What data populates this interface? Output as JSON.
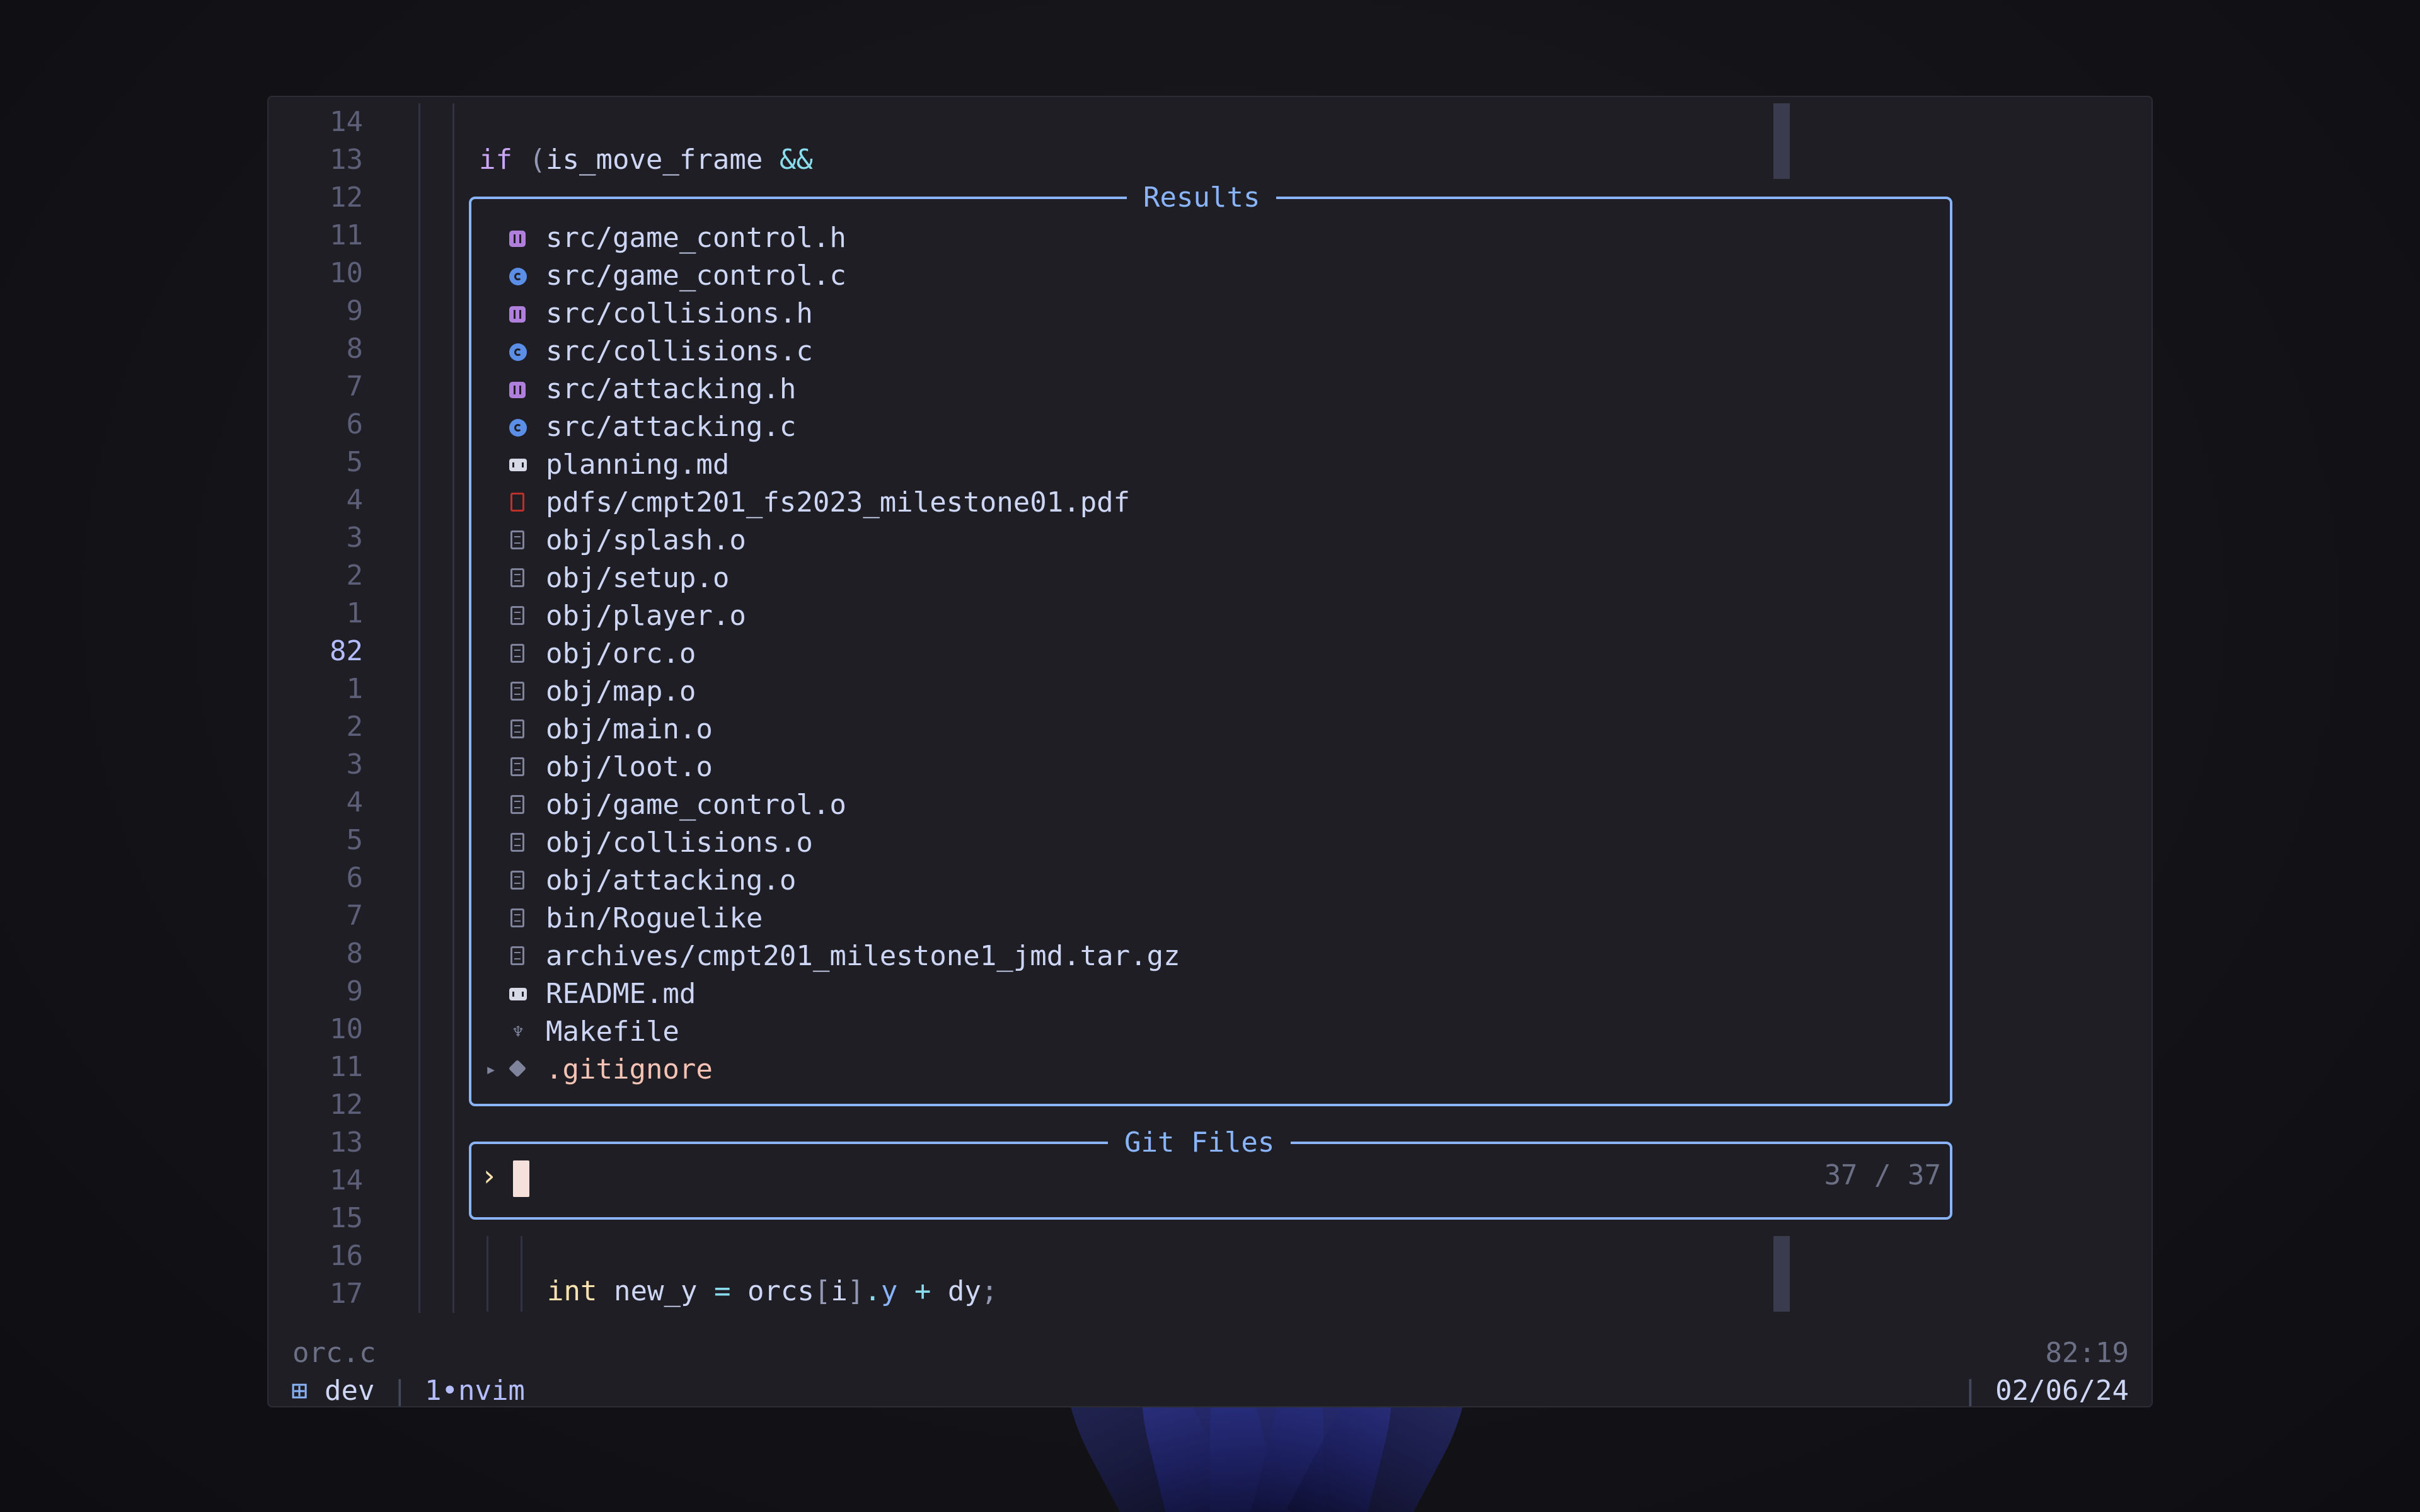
{
  "editor": {
    "line_numbers": [
      "14",
      "13",
      "12",
      "11",
      "10",
      "9",
      "8",
      "7",
      "6",
      "5",
      "4",
      "3",
      "2",
      "1",
      "82",
      "1",
      "2",
      "3",
      "4",
      "5",
      "6",
      "7",
      "8",
      "9",
      "10",
      "11",
      "12",
      "13",
      "14",
      "15",
      "16",
      "17"
    ],
    "current_line_index": 14,
    "code_line_top": {
      "keyword": "if",
      "paren": "(",
      "ident": "is_move_frame",
      "op": "&&"
    },
    "code_line_bottom": {
      "type": "int",
      "ident": "new_y",
      "eq": "=",
      "obj": "orcs",
      "lb": "[",
      "idx": "i",
      "rb": "]",
      "dot": ".",
      "field": "y",
      "plus": "+",
      "rhs": "dy",
      "semi": ";"
    }
  },
  "results": {
    "title": "Results",
    "items": [
      {
        "name": "src/game_control.h",
        "icon": "header-icon"
      },
      {
        "name": "src/game_control.c",
        "icon": "c-file-icon"
      },
      {
        "name": "src/collisions.h",
        "icon": "header-icon"
      },
      {
        "name": "src/collisions.c",
        "icon": "c-file-icon"
      },
      {
        "name": "src/attacking.h",
        "icon": "header-icon"
      },
      {
        "name": "src/attacking.c",
        "icon": "c-file-icon"
      },
      {
        "name": "planning.md",
        "icon": "markdown-icon"
      },
      {
        "name": "pdfs/cmpt201_fs2023_milestone01.pdf",
        "icon": "pdf-icon"
      },
      {
        "name": "obj/splash.o",
        "icon": "file-icon"
      },
      {
        "name": "obj/setup.o",
        "icon": "file-icon"
      },
      {
        "name": "obj/player.o",
        "icon": "file-icon"
      },
      {
        "name": "obj/orc.o",
        "icon": "file-icon"
      },
      {
        "name": "obj/map.o",
        "icon": "file-icon"
      },
      {
        "name": "obj/main.o",
        "icon": "file-icon"
      },
      {
        "name": "obj/loot.o",
        "icon": "file-icon"
      },
      {
        "name": "obj/game_control.o",
        "icon": "file-icon"
      },
      {
        "name": "obj/collisions.o",
        "icon": "file-icon"
      },
      {
        "name": "obj/attacking.o",
        "icon": "file-icon"
      },
      {
        "name": "bin/Roguelike",
        "icon": "file-icon"
      },
      {
        "name": "archives/cmpt201_milestone1_jmd.tar.gz",
        "icon": "file-icon"
      },
      {
        "name": "README.md",
        "icon": "markdown-icon"
      },
      {
        "name": "Makefile",
        "icon": "makefile-icon"
      },
      {
        "name": ".gitignore",
        "icon": "git-icon",
        "selected": true
      }
    ]
  },
  "prompt": {
    "title": "Git Files",
    "caret": "›",
    "count": "37 / 37"
  },
  "statusline": {
    "filename": "orc.c",
    "position": "82:19"
  },
  "tmux": {
    "session_icon": "⊞",
    "session": "dev",
    "sep": "|",
    "window": "1•nvim",
    "date_sep": "|",
    "date": "02/06/24"
  },
  "colors": {
    "accent": "#89b4fa",
    "keyword": "#cba6f7",
    "type": "#f9e2af",
    "operator": "#89dceb",
    "selected": "#f5c2b4"
  }
}
